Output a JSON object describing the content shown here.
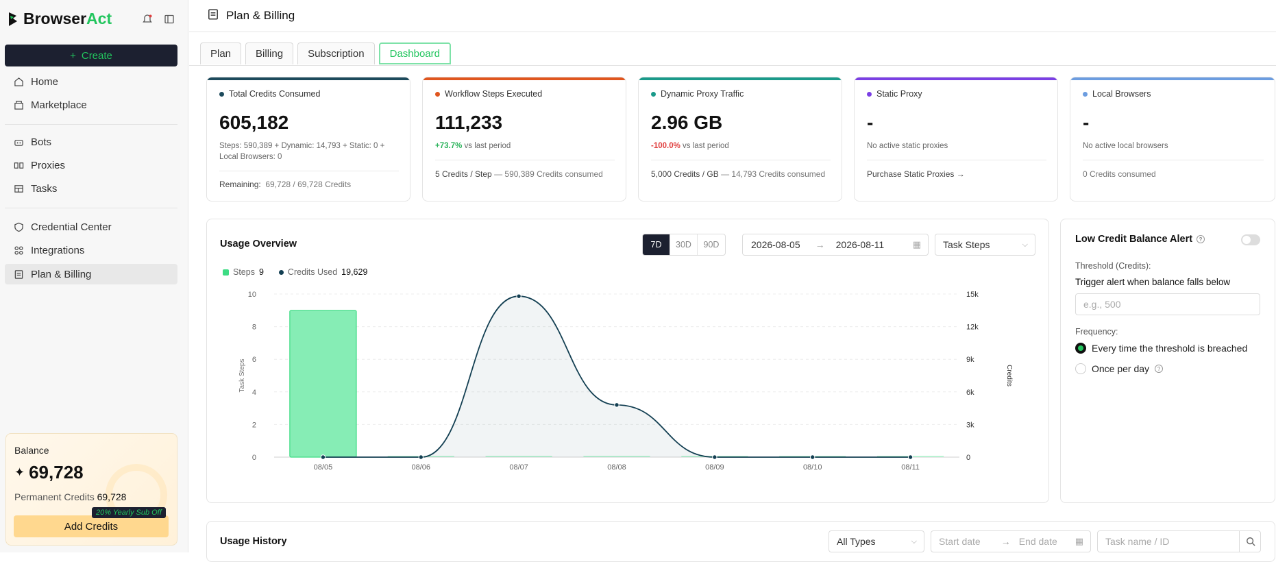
{
  "brand": {
    "name_main": "Browser",
    "name_accent": "Act"
  },
  "sidebar": {
    "create_label": "Create",
    "items": [
      {
        "label": "Home",
        "icon": "home-icon"
      },
      {
        "label": "Marketplace",
        "icon": "marketplace-icon"
      },
      {
        "label": "Bots",
        "icon": "bot-icon"
      },
      {
        "label": "Proxies",
        "icon": "proxy-icon"
      },
      {
        "label": "Tasks",
        "icon": "tasks-icon"
      },
      {
        "label": "Credential Center",
        "icon": "shield-icon"
      },
      {
        "label": "Integrations",
        "icon": "integrations-icon"
      },
      {
        "label": "Plan & Billing",
        "icon": "billing-icon",
        "active": true
      }
    ],
    "balance": {
      "label": "Balance",
      "value": "69,728",
      "permanent_label": "Permanent Credits",
      "permanent_value": "69,728",
      "promo": "20% Yearly Sub Off",
      "add_label": "Add Credits"
    }
  },
  "header": {
    "title": "Plan & Billing"
  },
  "tabs": [
    "Plan",
    "Billing",
    "Subscription",
    "Dashboard"
  ],
  "active_tab": "Dashboard",
  "cards": [
    {
      "label": "Total Credits Consumed",
      "value": "605,182",
      "sub": "Steps: 590,389 + Dynamic: 14,793 + Static: 0 + Local Browsers: 0",
      "foot_a": "Remaining:",
      "foot_b": "69,728 / 69,728 Credits",
      "color": "#1d4a5c"
    },
    {
      "label": "Workflow Steps Executed",
      "value": "111,233",
      "change": "+73.7%",
      "change_rest": "vs last period",
      "foot_a": "5 Credits / Step",
      "foot_b": "— 590,389 Credits consumed",
      "color": "#e0561f"
    },
    {
      "label": "Dynamic Proxy Traffic",
      "value": "2.96 GB",
      "change": "-100.0%",
      "change_rest": "vs last period",
      "foot_a": "5,000 Credits / GB",
      "foot_b": "— 14,793 Credits consumed",
      "color": "#1a9a8a"
    },
    {
      "label": "Static Proxy",
      "value": "-",
      "sub": "No active static proxies",
      "foot_link": "Purchase Static Proxies →",
      "color": "#7b3fe4"
    },
    {
      "label": "Local Browsers",
      "value": "-",
      "sub": "No active local browsers",
      "foot_b": "0 Credits consumed",
      "color": "#6c9de0"
    }
  ],
  "usage": {
    "title": "Usage Overview",
    "ranges": [
      "7D",
      "30D",
      "90D"
    ],
    "active_range": "7D",
    "date_from": "2026-08-05",
    "date_arrow": "→",
    "date_to": "2026-08-11",
    "metric_select": "Task Steps",
    "legend": [
      {
        "name": "Steps",
        "value": "9"
      },
      {
        "name": "Credits Used",
        "value": "19,629"
      }
    ]
  },
  "chart_data": {
    "type": "bar",
    "categories": [
      "08/05",
      "08/06",
      "08/07",
      "08/08",
      "08/09",
      "08/10",
      "08/11"
    ],
    "ylabel": "Task Steps",
    "y2label": "Credits",
    "ylim": [
      0,
      10
    ],
    "y2lim": [
      0,
      15000
    ],
    "yticks": [
      "0",
      "2",
      "4",
      "6",
      "8",
      "10"
    ],
    "y2ticks": [
      "0",
      "3k",
      "6k",
      "9k",
      "12k",
      "15k"
    ],
    "grid": true,
    "series": [
      {
        "name": "Steps",
        "type": "bar",
        "values": [
          9,
          0,
          0,
          0,
          0,
          0,
          0
        ],
        "color": "#3ddc84"
      },
      {
        "name": "Credits Used",
        "type": "area",
        "values": [
          0,
          0,
          14800,
          4800,
          0,
          0,
          0
        ],
        "color": "#133f52"
      }
    ]
  },
  "alert": {
    "title": "Low Credit Balance Alert",
    "threshold_label": "Threshold (Credits):",
    "trigger_label": "Trigger alert when balance falls below",
    "placeholder": "e.g., 500",
    "frequency_label": "Frequency:",
    "options": [
      "Every time the threshold is breached",
      "Once per day"
    ]
  },
  "history": {
    "title": "Usage History",
    "type_select": "All Types",
    "start_placeholder": "Start date",
    "arrow": "→",
    "end_placeholder": "End date",
    "search_placeholder": "Task name / ID"
  }
}
